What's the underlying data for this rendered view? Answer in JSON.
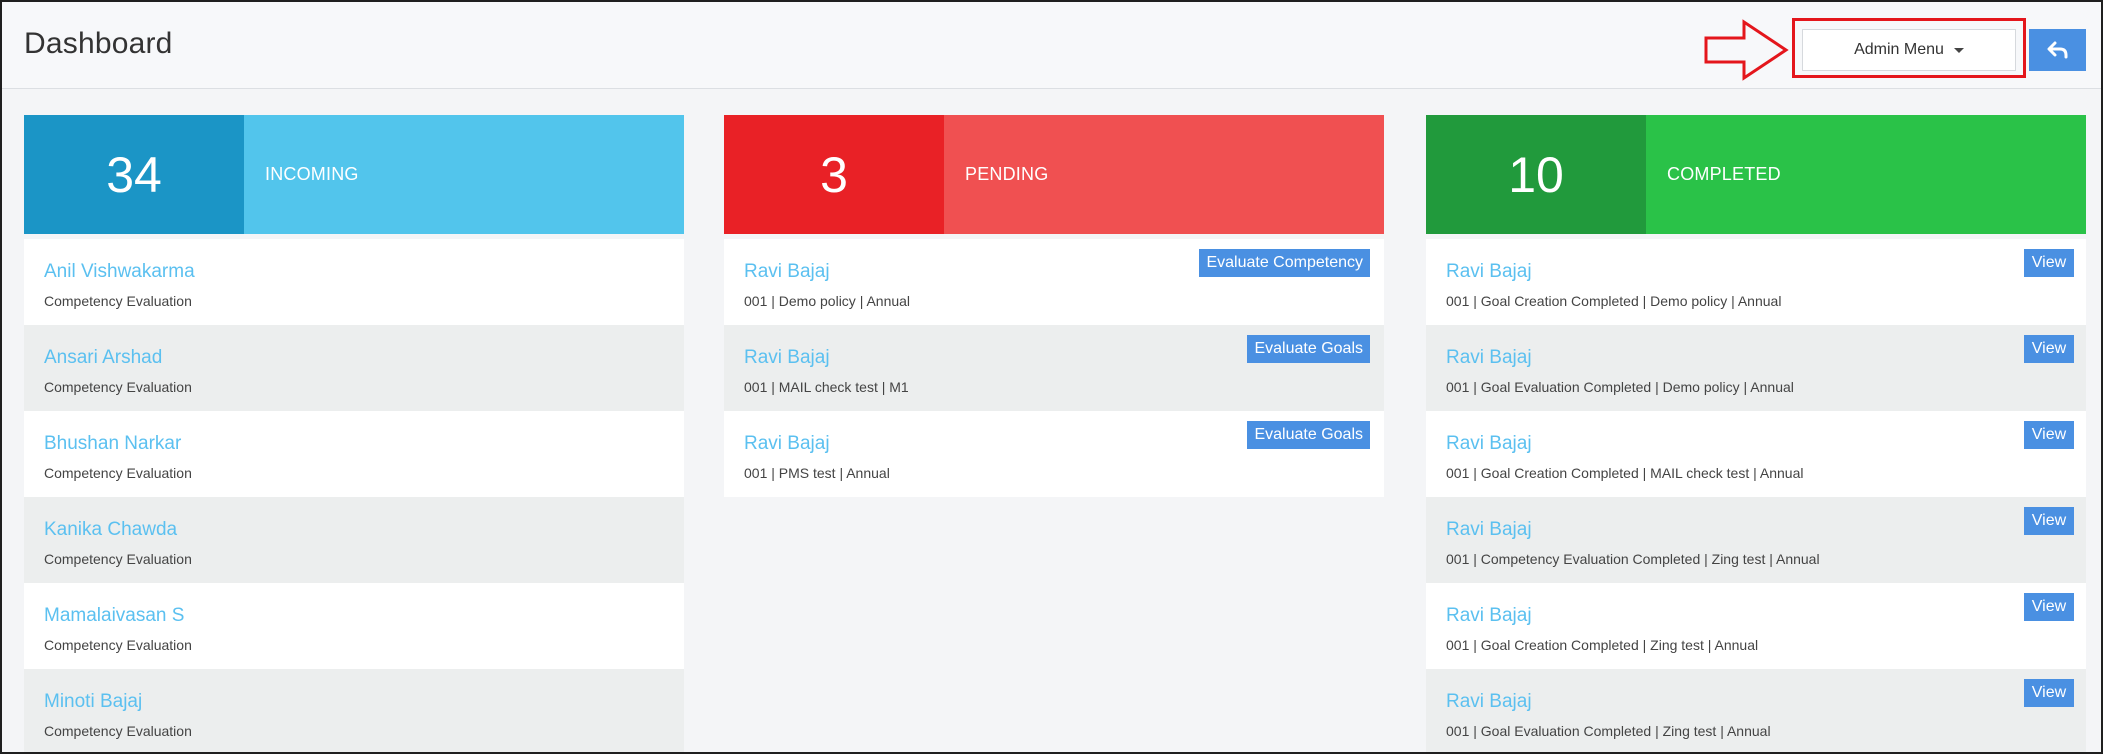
{
  "header": {
    "title": "Dashboard",
    "admin_menu_label": "Admin Menu",
    "back_icon": "undo-arrow-icon"
  },
  "colors": {
    "accent": "#4a90e2",
    "link": "#5bc0f0",
    "highlight": "#e4161c",
    "incoming_dark": "#1b95c6",
    "incoming_light": "#52c5ec",
    "pending_dark": "#e92126",
    "pending_light": "#f05051",
    "completed_dark": "#219a3c",
    "completed_light": "#2ac248"
  },
  "panels": {
    "incoming": {
      "count": "34",
      "label": "INCOMING",
      "items": [
        {
          "name": "Anil Vishwakarma",
          "sub": "Competency Evaluation"
        },
        {
          "name": "Ansari Arshad",
          "sub": "Competency Evaluation"
        },
        {
          "name": "Bhushan Narkar",
          "sub": "Competency Evaluation"
        },
        {
          "name": "Kanika Chawda",
          "sub": "Competency Evaluation"
        },
        {
          "name": "Mamalaivasan S",
          "sub": "Competency Evaluation"
        },
        {
          "name": "Minoti Bajaj",
          "sub": "Competency Evaluation"
        }
      ]
    },
    "pending": {
      "count": "3",
      "label": "PENDING",
      "items": [
        {
          "name": "Ravi Bajaj",
          "sub": "001 | Demo policy | Annual",
          "action": "Evaluate Competency"
        },
        {
          "name": "Ravi Bajaj",
          "sub": "001 | MAIL check test | M1",
          "action": "Evaluate Goals"
        },
        {
          "name": "Ravi Bajaj",
          "sub": "001 | PMS test | Annual",
          "action": "Evaluate Goals"
        }
      ]
    },
    "completed": {
      "count": "10",
      "label": "COMPLETED",
      "items": [
        {
          "name": "Ravi Bajaj",
          "sub": "001 | Goal Creation Completed | Demo policy | Annual",
          "action": "View"
        },
        {
          "name": "Ravi Bajaj",
          "sub": "001 | Goal Evaluation Completed | Demo policy | Annual",
          "action": "View"
        },
        {
          "name": "Ravi Bajaj",
          "sub": "001 | Goal Creation Completed | MAIL check test | Annual",
          "action": "View"
        },
        {
          "name": "Ravi Bajaj",
          "sub": "001 | Competency Evaluation Completed | Zing test | Annual",
          "action": "View"
        },
        {
          "name": "Ravi Bajaj",
          "sub": "001 | Goal Creation Completed | Zing test | Annual",
          "action": "View"
        },
        {
          "name": "Ravi Bajaj",
          "sub": "001 | Goal Evaluation Completed | Zing test | Annual",
          "action": "View"
        }
      ]
    }
  }
}
